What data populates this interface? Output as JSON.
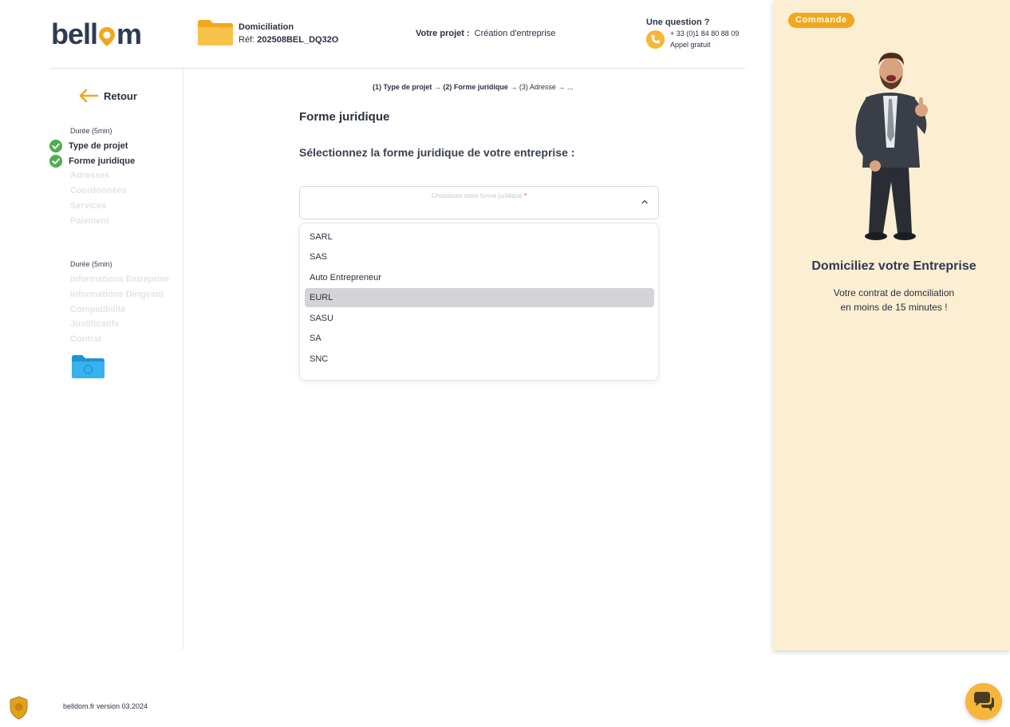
{
  "header": {
    "logo_left": "bell",
    "logo_right": "m",
    "domiciliation_label": "Domiciliation",
    "ref_prefix": "Réf:",
    "ref_value": "202508BEL_DQ32O",
    "projet_label": "Votre projet :",
    "projet_value": "Création d'entreprise",
    "question_title": "Une question ?",
    "phone_number": "+ 33 (0)1 84 80 88 09",
    "phone_note": "Appel gratuit"
  },
  "sidebar": {
    "retour_label": "Retour",
    "section1": {
      "duration": "Durée (5min)",
      "steps": [
        {
          "label": "Type de projet",
          "status": "done"
        },
        {
          "label": "Forme juridique",
          "status": "done"
        },
        {
          "label": "Adresses",
          "status": "todo"
        },
        {
          "label": "Coordonnées",
          "status": "todo"
        },
        {
          "label": "Services",
          "status": "todo"
        },
        {
          "label": "Paiement",
          "status": "todo"
        }
      ]
    },
    "section2": {
      "duration": "Durée (5min)",
      "steps": [
        {
          "label": "Informations Entreprise",
          "status": "todo"
        },
        {
          "label": "Informations Dirigeant",
          "status": "todo"
        },
        {
          "label": "Compatibilité",
          "status": "todo"
        },
        {
          "label": "Justificatifs",
          "status": "todo"
        },
        {
          "label": "Contrat",
          "status": "todo"
        }
      ]
    }
  },
  "main": {
    "breadcrumb": {
      "step1": "(1) Type de projet",
      "step2": "(2) Forme juridique",
      "step3": "(3) Adresse",
      "more": "..."
    },
    "title": "Forme juridique",
    "subtitle": "Sélectionnez la forme juridique de votre entreprise :",
    "select": {
      "placeholder": "Choisissez votre forme juridique",
      "required_mark": "*"
    },
    "options": [
      "SARL",
      "SAS",
      "Auto Entrepreneur",
      "EURL",
      "SASU",
      "SA",
      "SNC"
    ],
    "highlighted_option": "EURL"
  },
  "panel": {
    "badge": "Commande",
    "title": "Domiciliez votre Entreprise",
    "line1": "Votre contrat de domciliation",
    "line2": "en moins de 15 minutes !"
  },
  "footer": {
    "version": "belldom.fr version 03.2024"
  },
  "colors": {
    "accent": "#f5b63b",
    "badge": "#f0a81e",
    "panel_bg": "#fbeed2",
    "check_green": "#4caf50",
    "text_dark": "#2b3140"
  }
}
